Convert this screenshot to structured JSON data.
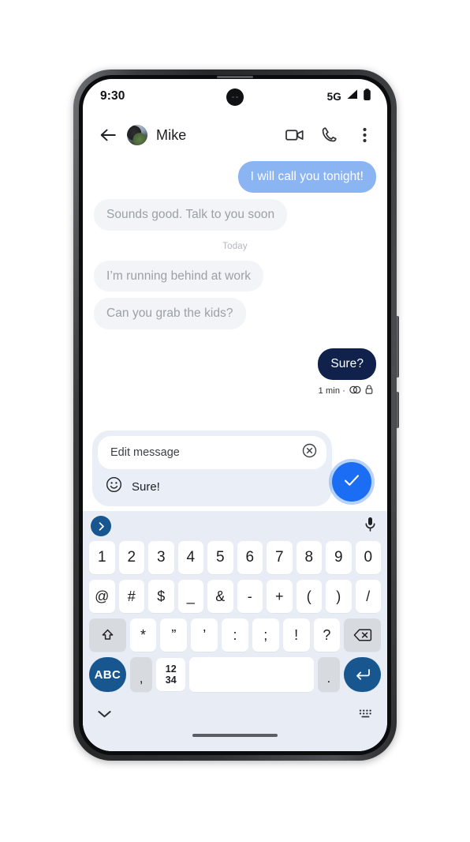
{
  "status_bar": {
    "time": "9:30",
    "network": "5G",
    "signal_icon": "signal-bars-icon",
    "battery_icon": "battery-full-icon",
    "camera_icon": "front-camera-punch-hole"
  },
  "header": {
    "back_icon": "back-arrow-icon",
    "avatar_icon": "contact-avatar",
    "contact_name": "Mike",
    "video_call_icon": "video-call-icon",
    "voice_call_icon": "phone-call-icon",
    "overflow_icon": "more-vertical-icon"
  },
  "conversation": {
    "messages": [
      {
        "text": "I will call you tonight!",
        "direction": "out",
        "style": "sent-old"
      },
      {
        "text": "Sounds good. Talk to you soon",
        "direction": "in",
        "style": "received"
      }
    ],
    "day_divider": "Today",
    "messages_today": [
      {
        "text": "I’m running behind at work",
        "direction": "in",
        "style": "received"
      },
      {
        "text": "Can you grab the kids?",
        "direction": "in",
        "style": "received"
      },
      {
        "text": "Sure?",
        "direction": "out",
        "style": "sent-dark"
      }
    ],
    "status": {
      "time_text": "1 min ·",
      "rcs_icon": "rcs-chat-icon",
      "lock_icon": "end-to-end-encrypted-lock-icon"
    }
  },
  "edit_panel": {
    "field_label": "Edit message",
    "clear_icon": "clear-circle-x-icon",
    "emoji_icon": "emoji-smiley-icon",
    "draft_text": "Sure!",
    "confirm_icon": "checkmark-icon"
  },
  "keyboard": {
    "suggestion_arrow_icon": "chevron-right-icon",
    "mic_icon": "microphone-icon",
    "row_numbers": [
      "1",
      "2",
      "3",
      "4",
      "5",
      "6",
      "7",
      "8",
      "9",
      "0"
    ],
    "row_symbols": [
      "@",
      "#",
      "$",
      "_",
      "&",
      "-",
      "+",
      "(",
      ")",
      "/"
    ],
    "shift_icon": "shift-up-arrow-icon",
    "row_punctuation": [
      "*",
      "”",
      "’",
      ":",
      ";",
      "!",
      "?"
    ],
    "backspace_icon": "backspace-delete-icon",
    "abc_label": "ABC",
    "comma_label": ",",
    "numsym_label_top": "12",
    "numsym_label_bottom": "34",
    "space_label": "",
    "period_label": ".",
    "enter_icon": "enter-return-icon",
    "hide_keyboard_icon": "chevron-down-icon",
    "switch_keyboard_icon": "keyboard-switch-icon"
  },
  "nav": {
    "home_indicator": "home-gesture-bar"
  },
  "colors": {
    "sent_old_bubble": "#8bb4f2",
    "received_bubble": "#f2f4f8",
    "sent_dark_bubble": "#10224c",
    "accent_blue": "#1b6ef3",
    "keyboard_bg": "#e8edf5",
    "key_mod": "#d7dbe0",
    "deep_blue": "#17568f"
  }
}
